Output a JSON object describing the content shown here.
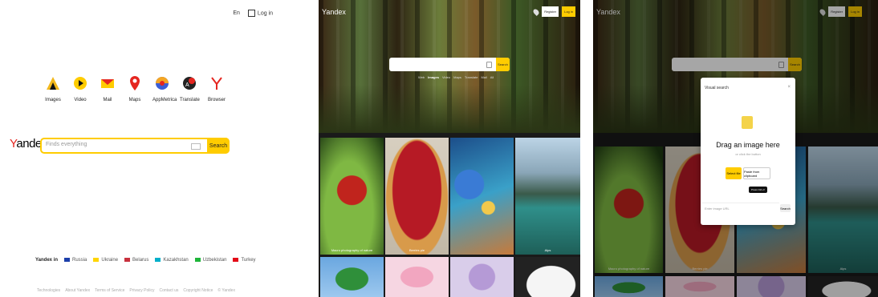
{
  "home": {
    "top": {
      "lang": "En",
      "login": "Log in"
    },
    "apps": [
      {
        "icon": "images-icon",
        "label": "Images",
        "color": "#f2b81d"
      },
      {
        "icon": "video-icon",
        "label": "Video",
        "color": "#ffcc00"
      },
      {
        "icon": "mail-icon",
        "label": "Mail",
        "color": "#e52620"
      },
      {
        "icon": "maps-icon",
        "label": "Maps",
        "color": "#e52620"
      },
      {
        "icon": "appmetrica-icon",
        "label": "AppMetrica",
        "color": "#f5a623"
      },
      {
        "icon": "translate-icon",
        "label": "Translate",
        "color": "#e52620"
      },
      {
        "icon": "browser-icon",
        "label": "Browser",
        "color": "#e52620"
      }
    ],
    "logo": {
      "first": "Y",
      "rest": "andex"
    },
    "search": {
      "placeholder": "Finds everything",
      "button": "Search"
    },
    "countries_lead": "Yandex in",
    "countries": [
      {
        "name": "Russia",
        "color": "#1c3faa"
      },
      {
        "name": "Ukraine",
        "color": "#ffd500"
      },
      {
        "name": "Belarus",
        "color": "#c8313e"
      },
      {
        "name": "Kazakhstan",
        "color": "#00afca"
      },
      {
        "name": "Uzbekistan",
        "color": "#1eb53a"
      },
      {
        "name": "Turkey",
        "color": "#e30a17"
      }
    ],
    "footer": [
      "Technologies",
      "About Yandex",
      "Terms of Service",
      "Privacy Policy",
      "Contact us",
      "Copyright Notice",
      "© Yandex"
    ]
  },
  "images_page": {
    "logo": "Yandex",
    "register": "Register",
    "login": "Log in",
    "search_button": "Search",
    "tabs": [
      "Web",
      "Images",
      "Video",
      "Maps",
      "Translate",
      "Mail",
      "All"
    ],
    "active_tab": "Images",
    "captions": [
      "Macro photography of nature",
      "Berries pie",
      "",
      "Alps"
    ]
  },
  "dialog": {
    "title": "Visual search",
    "close": "×",
    "heading": "Drag an image here",
    "or": "or click the button",
    "select": "Select file",
    "paste": "Paste from clipboard",
    "tooltip": "Press Ctrl+V",
    "url_placeholder": "Enter image URL",
    "url_button": "Search"
  }
}
